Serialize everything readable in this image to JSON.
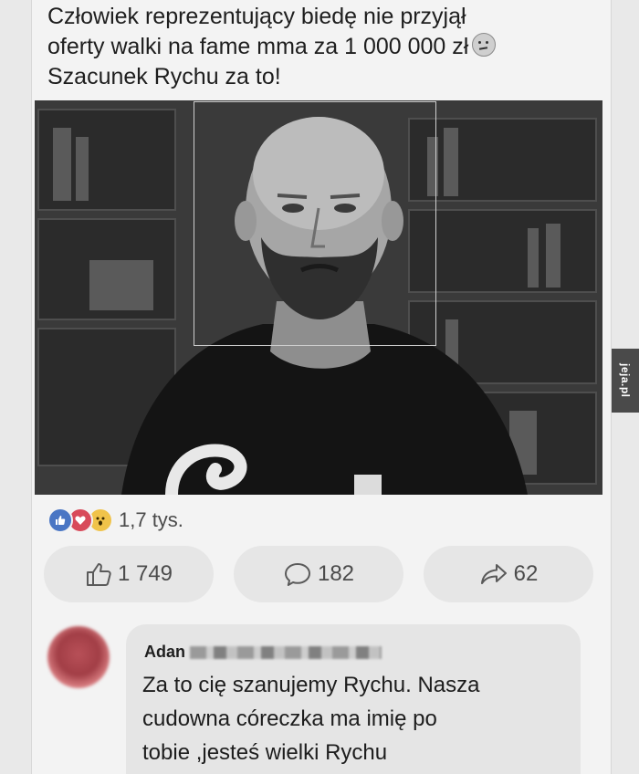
{
  "post": {
    "text_lines": [
      "Człowiek reprezentujący biedę nie przyjął",
      "oferty walki na fame mma za 1 000 000 zł",
      "Szacunek Rychu za to!"
    ],
    "emoji_icon": "thinking-face-icon"
  },
  "reactions": {
    "icons": [
      "like-reaction-icon",
      "love-reaction-icon",
      "wow-reaction-icon"
    ],
    "count": "1,7 tys."
  },
  "actions": {
    "like_count": "1 749",
    "comment_count": "182",
    "share_count": "62"
  },
  "comment": {
    "author": "Adan",
    "lines": [
      "Za to cię szanujemy Rychu. Nasza",
      "cudowna córeczka ma imię po",
      "tobie ,jesteś wielki Rychu"
    ]
  },
  "watermark": "jeja.pl",
  "colors": {
    "like_blue": "#4a76c4",
    "love_red": "#d84a5a",
    "wow_yellow": "#f0c34a",
    "card_bg": "#f3f3f3",
    "button_bg": "#e6e6e6"
  }
}
